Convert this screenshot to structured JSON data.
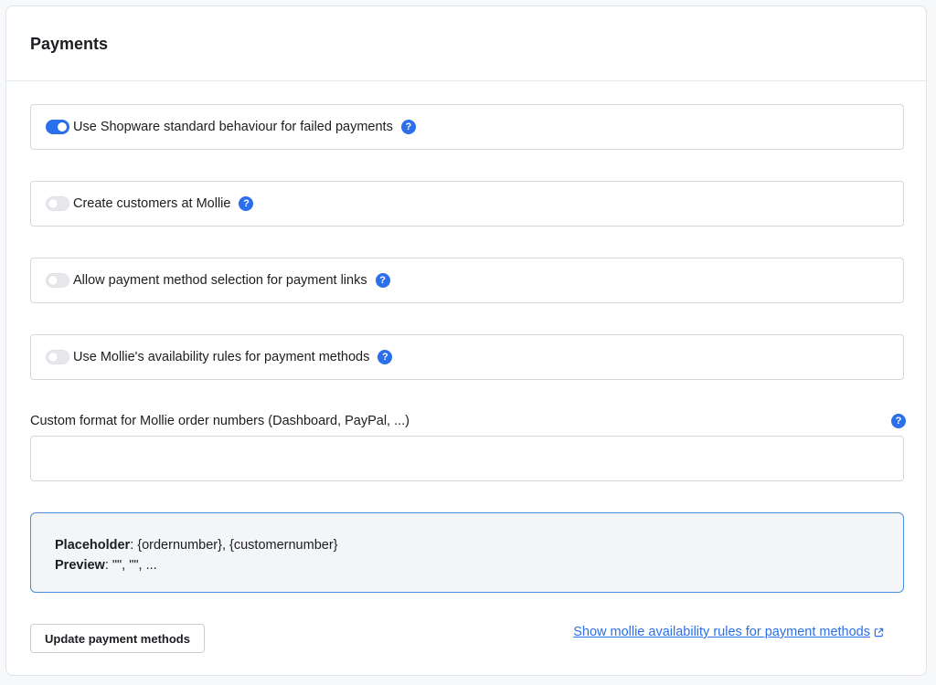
{
  "card": {
    "title": "Payments"
  },
  "toggles": [
    {
      "label": "Use Shopware standard behaviour for failed payments",
      "checked": true
    },
    {
      "label": "Create customers at Mollie",
      "checked": false
    },
    {
      "label": "Allow payment method selection for payment links",
      "checked": false
    },
    {
      "label": "Use Mollie's availability rules for payment methods",
      "checked": false
    }
  ],
  "help_icon": {
    "glyph": "?",
    "icon": "help-icon"
  },
  "order_number_field": {
    "label": "Custom format for Mollie order numbers (Dashboard, PayPal, ...)",
    "value": ""
  },
  "info": {
    "placeholder_label": "Placeholder",
    "placeholder_value": ": {ordernumber}, {customernumber}",
    "preview_label": "Preview",
    "preview_value": ": \"\", \"\", ..."
  },
  "actions": {
    "update_button": "Update payment methods",
    "rules_link": "Show mollie availability rules for payment methods"
  },
  "colors": {
    "accent": "#2b6fea",
    "info_border": "#4a90e2",
    "info_bg": "#f4f5f6"
  }
}
